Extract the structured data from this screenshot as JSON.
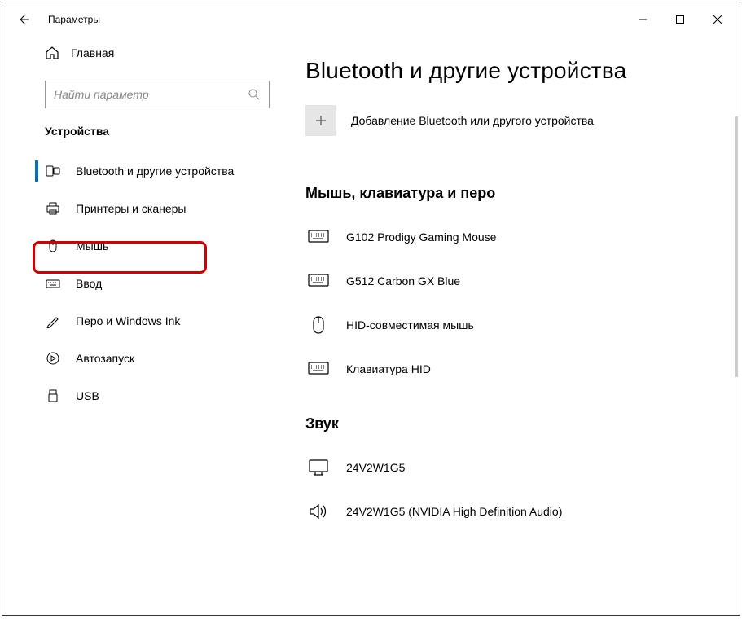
{
  "titlebar": {
    "app_title": "Параметры"
  },
  "sidebar": {
    "home_label": "Главная",
    "search_placeholder": "Найти параметр",
    "category_title": "Устройства",
    "items": [
      {
        "label": "Bluetooth и другие устройства"
      },
      {
        "label": "Принтеры и сканеры"
      },
      {
        "label": "Мышь"
      },
      {
        "label": "Ввод"
      },
      {
        "label": "Перо и Windows Ink"
      },
      {
        "label": "Автозапуск"
      },
      {
        "label": "USB"
      }
    ]
  },
  "main": {
    "page_title": "Bluetooth и другие устройства",
    "add_device_label": "Добавление Bluetooth или другого устройства",
    "sections": [
      {
        "header": "Мышь, клавиатура и перо",
        "devices": [
          {
            "label": "G102 Prodigy Gaming Mouse"
          },
          {
            "label": "G512 Carbon GX Blue"
          },
          {
            "label": "HID-совместимая мышь"
          },
          {
            "label": "Клавиатура HID"
          }
        ]
      },
      {
        "header": "Звук",
        "devices": [
          {
            "label": "24V2W1G5"
          },
          {
            "label": "24V2W1G5 (NVIDIA High Definition Audio)"
          }
        ]
      }
    ]
  }
}
